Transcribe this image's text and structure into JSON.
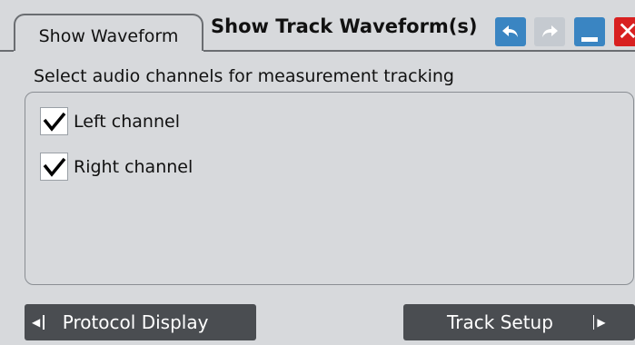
{
  "tab": {
    "label": "Show Waveform"
  },
  "dialog": {
    "title": "Show Track Waveform(s)"
  },
  "toolbar": {
    "undo_icon": "undo-icon",
    "redo_icon": "redo-icon",
    "minimize_icon": "minimize-icon",
    "close_icon": "close-icon",
    "colors": {
      "undo": "#3a85c2",
      "redo_disabled": "#c5cad0",
      "minimize": "#3a85c2",
      "close": "#d82020"
    }
  },
  "section": {
    "label": "Select audio channels for measurement tracking"
  },
  "channels": [
    {
      "label": "Left channel",
      "checked": true
    },
    {
      "label": "Right channel",
      "checked": true
    }
  ],
  "nav": {
    "prev_label": "Protocol Display",
    "next_label": "Track Setup"
  }
}
